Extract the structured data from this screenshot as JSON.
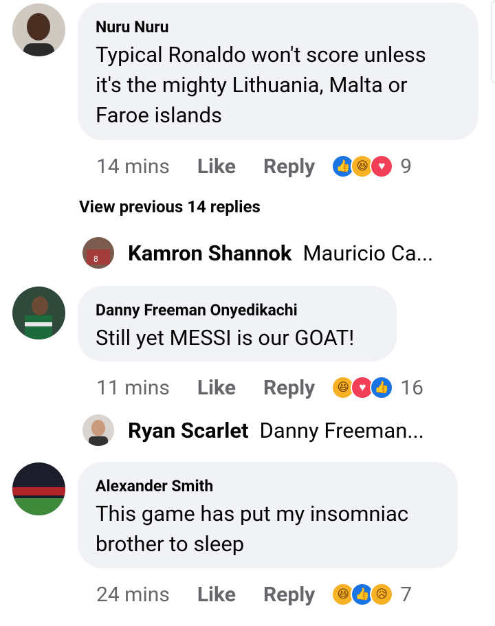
{
  "comments": [
    {
      "author": "Nuru Nuru",
      "text_lines": [
        "Typical Ronaldo won't score unless",
        "it's the mighty Lithuania, Malta or",
        "Faroe islands"
      ],
      "time": "14 mins",
      "like_label": "Like",
      "reply_label": "Reply",
      "reactions": [
        "like",
        "haha",
        "love"
      ],
      "reaction_count": "9"
    },
    {
      "author": "Danny Freeman Onyedikachi",
      "text_lines": [
        "Still yet MESSI is our GOAT!"
      ],
      "time": "11 mins",
      "like_label": "Like",
      "reply_label": "Reply",
      "reactions": [
        "haha",
        "love",
        "like"
      ],
      "reaction_count": "16"
    },
    {
      "author": "Alexander Smith",
      "text_lines": [
        "This game has put my insomniac",
        "brother to sleep"
      ],
      "time": "24 mins",
      "like_label": "Like",
      "reply_label": "Reply",
      "reactions": [
        "haha",
        "like",
        "sad"
      ],
      "reaction_count": "7"
    }
  ],
  "view_previous": "View previous 14 replies",
  "replies": [
    {
      "name": "Kamron Shannok",
      "preview": "Mauricio Ca..."
    },
    {
      "name": "Ryan Scarlet",
      "preview": "Danny Freeman..."
    }
  ]
}
